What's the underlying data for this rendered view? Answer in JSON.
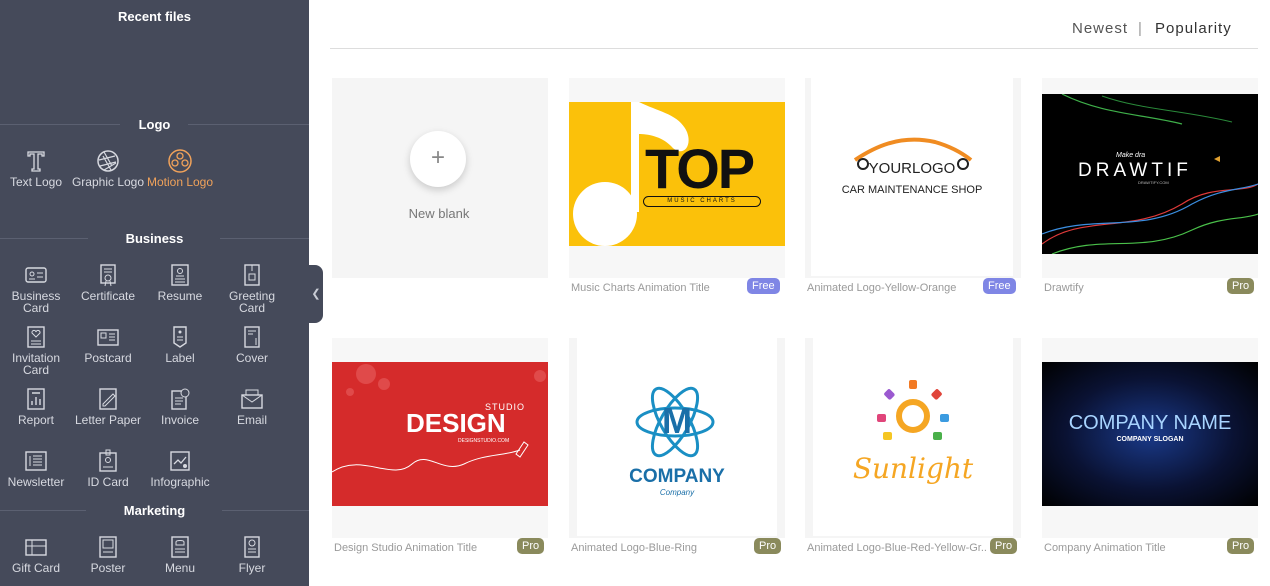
{
  "sidebar": {
    "recent_title": "Recent files",
    "logo_title": "Logo",
    "business_title": "Business",
    "marketing_title": "Marketing",
    "logo_items": [
      {
        "label": "Text Logo",
        "icon": "text-T-icon"
      },
      {
        "label": "Graphic Logo",
        "icon": "aperture-icon"
      },
      {
        "label": "Motion Logo",
        "icon": "film-reel-icon"
      }
    ],
    "business_items": [
      {
        "label": "Business Card",
        "icon": "id-card-icon"
      },
      {
        "label": "Certificate",
        "icon": "certificate-icon"
      },
      {
        "label": "Resume",
        "icon": "resume-icon"
      },
      {
        "label": "Greeting Card",
        "icon": "greeting-card-icon"
      },
      {
        "label": "Invitation Card",
        "icon": "invitation-icon"
      },
      {
        "label": "Postcard",
        "icon": "postcard-icon"
      },
      {
        "label": "Label",
        "icon": "label-tag-icon"
      },
      {
        "label": "Cover",
        "icon": "cover-icon"
      },
      {
        "label": "Report",
        "icon": "report-icon"
      },
      {
        "label": "Letter Paper",
        "icon": "letter-paper-icon"
      },
      {
        "label": "Invoice",
        "icon": "invoice-icon"
      },
      {
        "label": "Email",
        "icon": "email-icon"
      },
      {
        "label": "Newsletter",
        "icon": "newsletter-icon"
      },
      {
        "label": "ID Card",
        "icon": "id-badge-icon"
      },
      {
        "label": "Infographic",
        "icon": "infographic-icon"
      }
    ],
    "marketing_items": [
      {
        "label": "Gift Card",
        "icon": "gift-card-icon"
      },
      {
        "label": "Poster",
        "icon": "poster-icon"
      },
      {
        "label": "Menu",
        "icon": "menu-card-icon"
      },
      {
        "label": "Flyer",
        "icon": "flyer-icon"
      }
    ],
    "active_color": "#f0a25a"
  },
  "sort": {
    "newest": "Newest",
    "separator": "|",
    "popularity": "Popularity"
  },
  "new_blank": {
    "label": "New blank",
    "plus": "+"
  },
  "templates": [
    {
      "title": "Music Charts Animation Title",
      "badge": "Free",
      "art": {
        "main": "TOP",
        "sub": "MUSIC CHARTS"
      }
    },
    {
      "title": "Animated Logo-Yellow-Orange",
      "badge": "Free",
      "art": {
        "main": "YOURLOGO",
        "sub": "CAR MAINTENANCE SHOP"
      }
    },
    {
      "title": "Drawtify",
      "badge": "Pro",
      "art": {
        "top": "Make dra",
        "main": "DRAWTIF",
        "sub": "DRAWTIFY.COM"
      }
    },
    {
      "title": "Design Studio Animation Title",
      "badge": "Pro",
      "art": {
        "top": "STUDIO",
        "main": "DESIGN",
        "sub": "DESIGNSTUDIO.COM"
      }
    },
    {
      "title": "Animated Logo-Blue-Ring",
      "badge": "Pro",
      "art": {
        "letter": "M",
        "main": "COMPANY",
        "sub": "Company"
      }
    },
    {
      "title": "Animated Logo-Blue-Red-Yellow-Gr...",
      "badge": "Pro",
      "art": {
        "main": "Sunlight"
      }
    },
    {
      "title": "Company Animation Title",
      "badge": "Pro",
      "art": {
        "main": "COMPANY NAME",
        "sub": "COMPANY SLOGAN"
      }
    }
  ]
}
